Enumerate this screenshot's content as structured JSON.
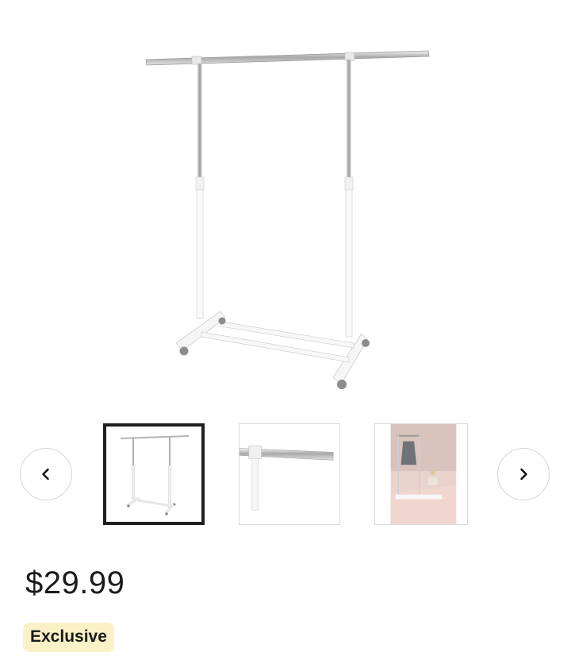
{
  "product": {
    "hero_image": "garment-rack-image",
    "price": "$29.99",
    "badge": "Exclusive"
  },
  "carousel": {
    "prev_icon": "chevron-left-icon",
    "next_icon": "chevron-right-icon",
    "thumbnails": [
      {
        "image": "garment-rack-full-view",
        "selected": true
      },
      {
        "image": "garment-rack-bar-closeup",
        "selected": false
      },
      {
        "image": "garment-rack-in-room",
        "selected": false
      }
    ]
  },
  "colors": {
    "badge_background": "#fbf1c7",
    "selected_thumb_border": "#1f1f1f"
  }
}
